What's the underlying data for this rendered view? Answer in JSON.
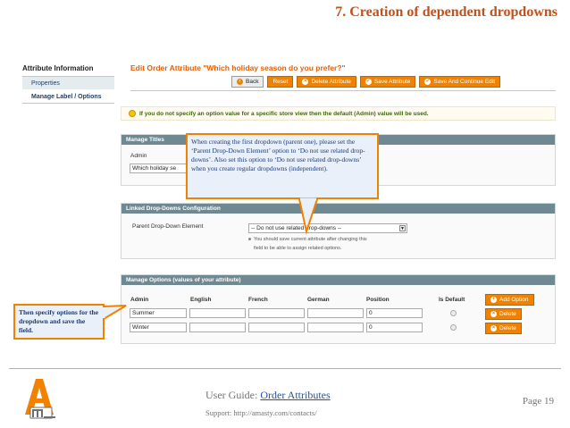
{
  "slide": {
    "title": "7. Creation of dependent dropdowns",
    "page": "Page 19"
  },
  "sidebar": {
    "heading": "Attribute Information",
    "items": [
      {
        "label": "Properties"
      },
      {
        "label": "Manage Label / Options"
      }
    ]
  },
  "header": {
    "title": "Edit Order Attribute \"Which holiday season do you prefer?\"",
    "buttons": {
      "back": "Back",
      "reset": "Reset",
      "delete": "Delete Attribute",
      "save": "Save Attribute",
      "save_continue": "Save And Continue Edit"
    }
  },
  "notice": "If you do not specify an option value for a specific store view then the default (Admin) value will be used.",
  "manage_titles": {
    "heading": "Manage Titles",
    "admin_label": "Admin",
    "admin_value": "Which holiday se"
  },
  "linked": {
    "heading": "Linked Drop-Downs Configuration",
    "field_label": "Parent Drop-Down Element",
    "selected": "-- Do not use related drop-downs --",
    "hint_line1": "You should save current attribute after changing this",
    "hint_line2": "field to be able to assign related options."
  },
  "options": {
    "heading": "Manage Options (values of your attribute)",
    "columns": [
      "Admin",
      "English",
      "French",
      "German",
      "Position",
      "Is Default"
    ],
    "add_label": "Add Option",
    "delete_label": "Delete",
    "rows": [
      {
        "admin": "Summer",
        "english": "",
        "french": "",
        "german": "",
        "position": "0"
      },
      {
        "admin": "Winter",
        "english": "",
        "french": "",
        "german": "",
        "position": "0"
      }
    ]
  },
  "callouts": {
    "first": "When creating the first dropdown (parent one), please set the ‘Parent Drop-Down Element’ option to ‘Do not use related drop-downs’. Also set this option to ‘Do not use related drop-downs’ when you create regular dropdowns (independent).",
    "second": "Then specify options for the dropdown and save the field."
  },
  "footer": {
    "guide_prefix": "User Guide: ",
    "guide_link": "Order Attributes",
    "support": "Support: http://amasty.com/contacts/"
  },
  "colors": {
    "accent": "#f18200",
    "title_orange": "#c0511a",
    "section_header": "#6f8992",
    "callout_bg": "#eaf0fa"
  }
}
